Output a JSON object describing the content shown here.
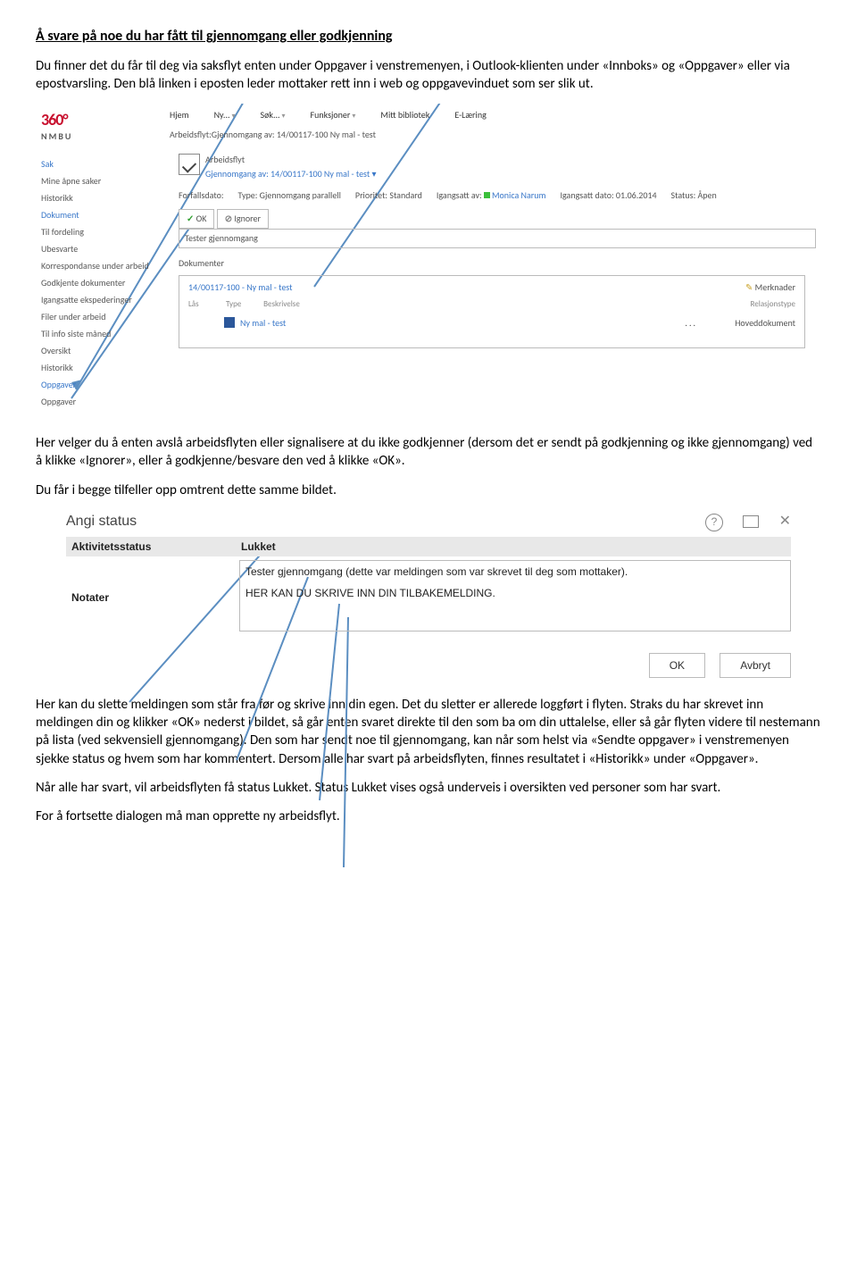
{
  "doc": {
    "heading": "Å svare på noe du har fått til gjennomgang eller godkjenning",
    "p1": "Du finner det du får til deg via saksflyt enten under Oppgaver i venstremenyen, i Outlook-klienten under «Innboks» og «Oppgaver» eller via epostvarsling. Den blå linken i eposten leder mottaker rett inn i web og oppgavevinduet som ser slik ut.",
    "p2": "Her velger du å enten avslå arbeidsflyten eller signalisere at du ikke godkjenner (dersom det er sendt på godkjenning og ikke gjennomgang) ved å klikke «Ignorer», eller å godkjenne/besvare den ved å klikke «OK».",
    "p3": "Du får i begge tilfeller opp omtrent dette samme bildet.",
    "p4": "Her kan du slette meldingen som står fra før og skrive inn din egen. Det du sletter er allerede loggført i flyten. Straks du har skrevet inn meldingen din og klikker «OK» nederst i bildet, så går enten svaret direkte til den som ba om din uttalelse, eller så går flyten videre til nestemann på lista (ved sekvensiell gjennomgang). Den som har sendt noe til gjennomgang, kan når som helst via «Sendte oppgaver» i venstremenyen sjekke status og hvem som har kommentert. Dersom alle har svart på arbeidsflyten, finnes resultatet i «Historikk» under «Oppgaver».",
    "p5": "Når alle har svart, vil arbeidsflyten få status Lukket. Status Lukket vises også underveis i oversikten ved personer som har svart.",
    "p6": "For å fortsette dialogen må man opprette ny arbeidsflyt."
  },
  "ss1": {
    "logo360": "360",
    "logoNmbu": "NMBU",
    "nav": {
      "hjem": "Hjem",
      "ny": "Ny...",
      "sok": "Søk...",
      "funk": "Funksjoner",
      "bib": "Mitt bibliotek",
      "elar": "E-Læring"
    },
    "breadcrumb": "Arbeidsflyt:Gjennomgang av: 14/00117-100 Ny mal - test",
    "sidebar": {
      "sak": "Sak",
      "mineApne": "Mine åpne saker",
      "histTop": "Historikk",
      "dokument": "Dokument",
      "tilFordeling": "Til fordeling",
      "ubesvarte": "Ubesvarte",
      "korr": "Korrespondanse under arbeid",
      "godkj": "Godkjente dokumenter",
      "igang": "Igangsatte ekspederinger",
      "filer": "Filer under arbeid",
      "tilInfo": "Til info siste måned",
      "oversikt": "Oversikt",
      "histBot": "Historikk",
      "oppgHead": "Oppgaver",
      "oppg": "Oppgaver"
    },
    "wf": {
      "label": "Arbeidsflyt",
      "link": "Gjennomgang av: 14/00117-100 Ny mal - test",
      "metaForfall": "Forfallsdato:",
      "metaType": "Type: Gjennomgang parallell",
      "metaPrio": "Prioritet: Standard",
      "metaIgAv": "Igangsatt av:",
      "metaUser": "Monica Narum",
      "metaDate": "Igangsatt dato: 01.06.2014",
      "metaStatus": "Status: Åpen",
      "okBtn": "OK",
      "ignBtn": "Ignorer",
      "testerBox": "Tester gjennomgang",
      "docsLabel": "Dokumenter",
      "docLink": "14/00117-100 - Ny mal - test",
      "merk": "Merknader",
      "hdrLas": "Lås",
      "hdrType": "Type",
      "hdrBesk": "Beskrivelse",
      "hdrRel": "Relasjonstype",
      "docRow": "Ny mal - test",
      "hoved": "Hoveddokument"
    }
  },
  "ss2": {
    "title": "Angi status",
    "lbl1": "Aktivitetsstatus",
    "val1": "Lukket",
    "lbl2": "Notater",
    "line1": "Tester gjennomgang (dette var meldingen som var skrevet til deg som mottaker).",
    "line2": "HER KAN DU SKRIVE INN DIN TILBAKEMELDING.",
    "ok": "OK",
    "avbryt": "Avbryt"
  }
}
